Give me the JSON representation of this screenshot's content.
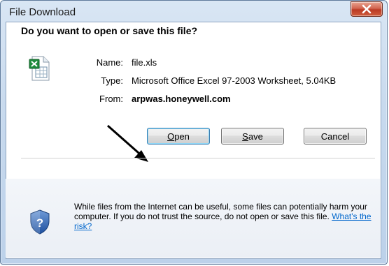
{
  "window": {
    "title": "File Download",
    "close_label": "X"
  },
  "prompt": {
    "heading": "Do you want to open or save this file?"
  },
  "file": {
    "icon": "excel-file-icon",
    "name_label": "Name:",
    "name_value": "file.xls",
    "type_label": "Type:",
    "type_value": "Microsoft Office Excel 97-2003 Worksheet, 5.04KB",
    "from_label": "From:",
    "from_value": "arpwas.honeywell.com"
  },
  "buttons": {
    "open": "Open",
    "save": "Save",
    "cancel": "Cancel"
  },
  "warning": {
    "icon": "shield-question-icon",
    "text": "While files from the Internet can be useful, some files can potentially harm your computer. If you do not trust the source, do not open or save this file.",
    "link": "What's the risk?"
  },
  "colors": {
    "accent_link": "#0066cc",
    "close_red": "#c8472c",
    "frame_blue": "#c8daee"
  }
}
